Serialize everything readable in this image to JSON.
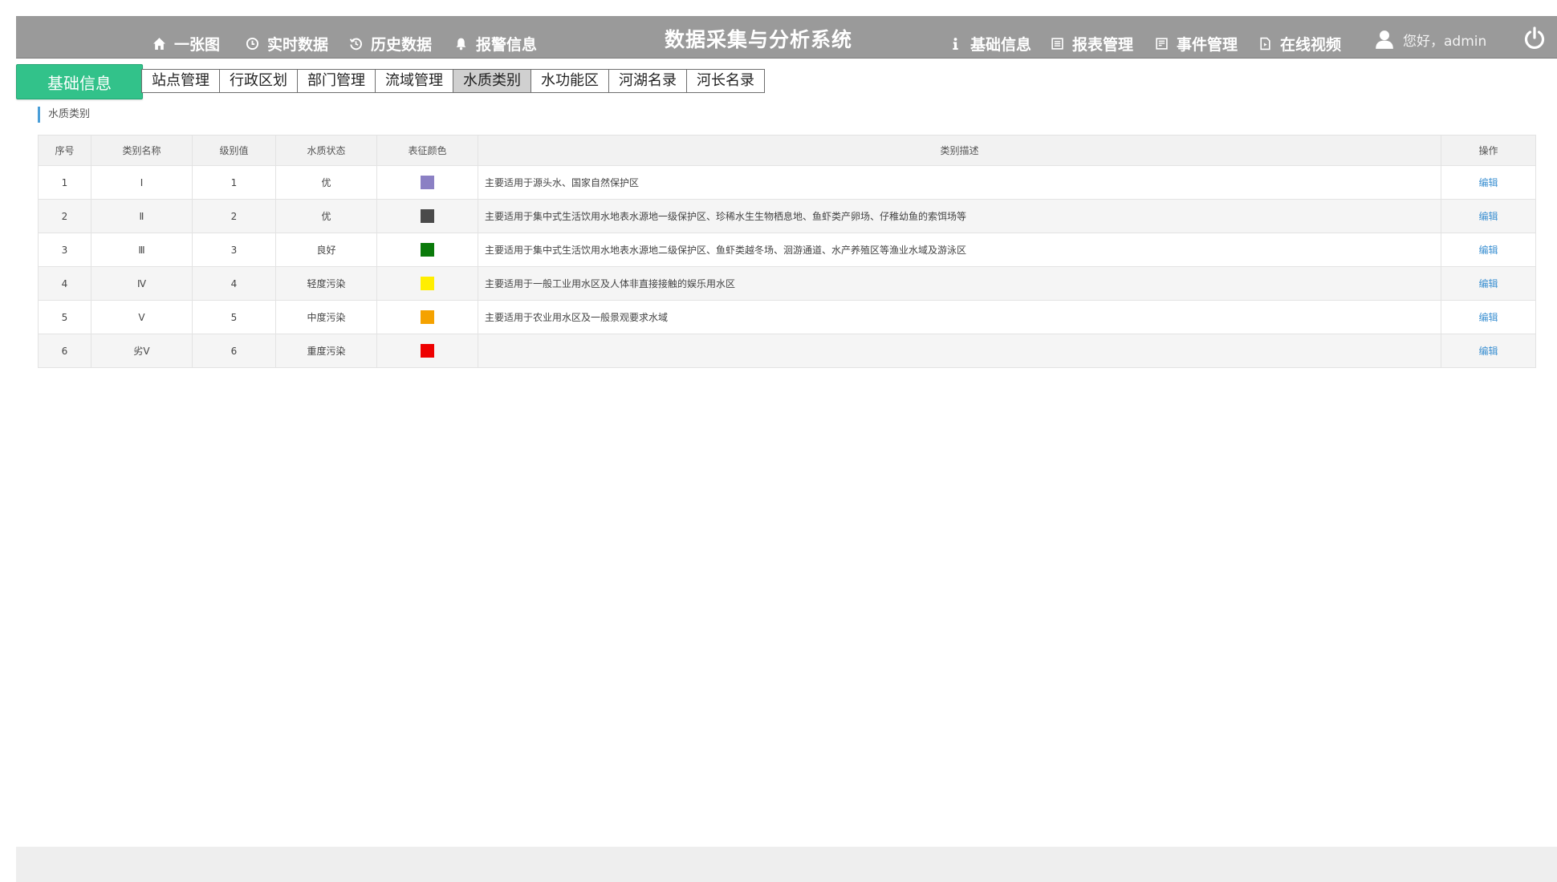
{
  "header": {
    "title": "数据采集与分析系统",
    "left_nav": [
      {
        "label": "一张图",
        "icon": "home-icon"
      },
      {
        "label": "实时数据",
        "icon": "clock-icon"
      },
      {
        "label": "历史数据",
        "icon": "history-icon"
      },
      {
        "label": "报警信息",
        "icon": "bell-icon"
      }
    ],
    "right_nav": [
      {
        "label": "基础信息",
        "icon": "info-icon"
      },
      {
        "label": "报表管理",
        "icon": "report-icon"
      },
      {
        "label": "事件管理",
        "icon": "event-icon"
      },
      {
        "label": "在线视频",
        "icon": "video-icon"
      }
    ],
    "greeting": "您好，admin",
    "user_icon": "user-icon",
    "power_icon": "power-icon"
  },
  "section_badge": "基础信息",
  "subtabs": [
    {
      "label": "站点管理",
      "active": false
    },
    {
      "label": "行政区划",
      "active": false
    },
    {
      "label": "部门管理",
      "active": false
    },
    {
      "label": "流域管理",
      "active": false
    },
    {
      "label": "水质类别",
      "active": true
    },
    {
      "label": "水功能区",
      "active": false
    },
    {
      "label": "河湖名录",
      "active": false
    },
    {
      "label": "河长名录",
      "active": false
    }
  ],
  "page_heading": "水质类别",
  "table": {
    "columns": [
      "序号",
      "类别名称",
      "级别值",
      "水质状态",
      "表征颜色",
      "类别描述",
      "操作"
    ],
    "rows": [
      {
        "index": "1",
        "name": "Ⅰ",
        "level": "1",
        "status": "优",
        "color": "#8b80c4",
        "desc": "主要适用于源头水、国家自然保护区",
        "action": "编辑"
      },
      {
        "index": "2",
        "name": "Ⅱ",
        "level": "2",
        "status": "优",
        "color": "#4a4a4a",
        "desc": "主要适用于集中式生活饮用水地表水源地一级保护区、珍稀水生生物栖息地、鱼虾类产卵场、仔稚幼鱼的索饵场等",
        "action": "编辑"
      },
      {
        "index": "3",
        "name": "Ⅲ",
        "level": "3",
        "status": "良好",
        "color": "#0a7a0a",
        "desc": "主要适用于集中式生活饮用水地表水源地二级保护区、鱼虾类越冬场、洄游通道、水产养殖区等渔业水域及游泳区",
        "action": "编辑"
      },
      {
        "index": "4",
        "name": "Ⅳ",
        "level": "4",
        "status": "轻度污染",
        "color": "#ffee00",
        "desc": "主要适用于一般工业用水区及人体非直接接触的娱乐用水区",
        "action": "编辑"
      },
      {
        "index": "5",
        "name": "Ⅴ",
        "level": "5",
        "status": "中度污染",
        "color": "#f5a200",
        "desc": "主要适用于农业用水区及一般景观要求水域",
        "action": "编辑"
      },
      {
        "index": "6",
        "name": "劣Ⅴ",
        "level": "6",
        "status": "重度污染",
        "color": "#ee0000",
        "desc": "",
        "action": "编辑"
      }
    ]
  }
}
